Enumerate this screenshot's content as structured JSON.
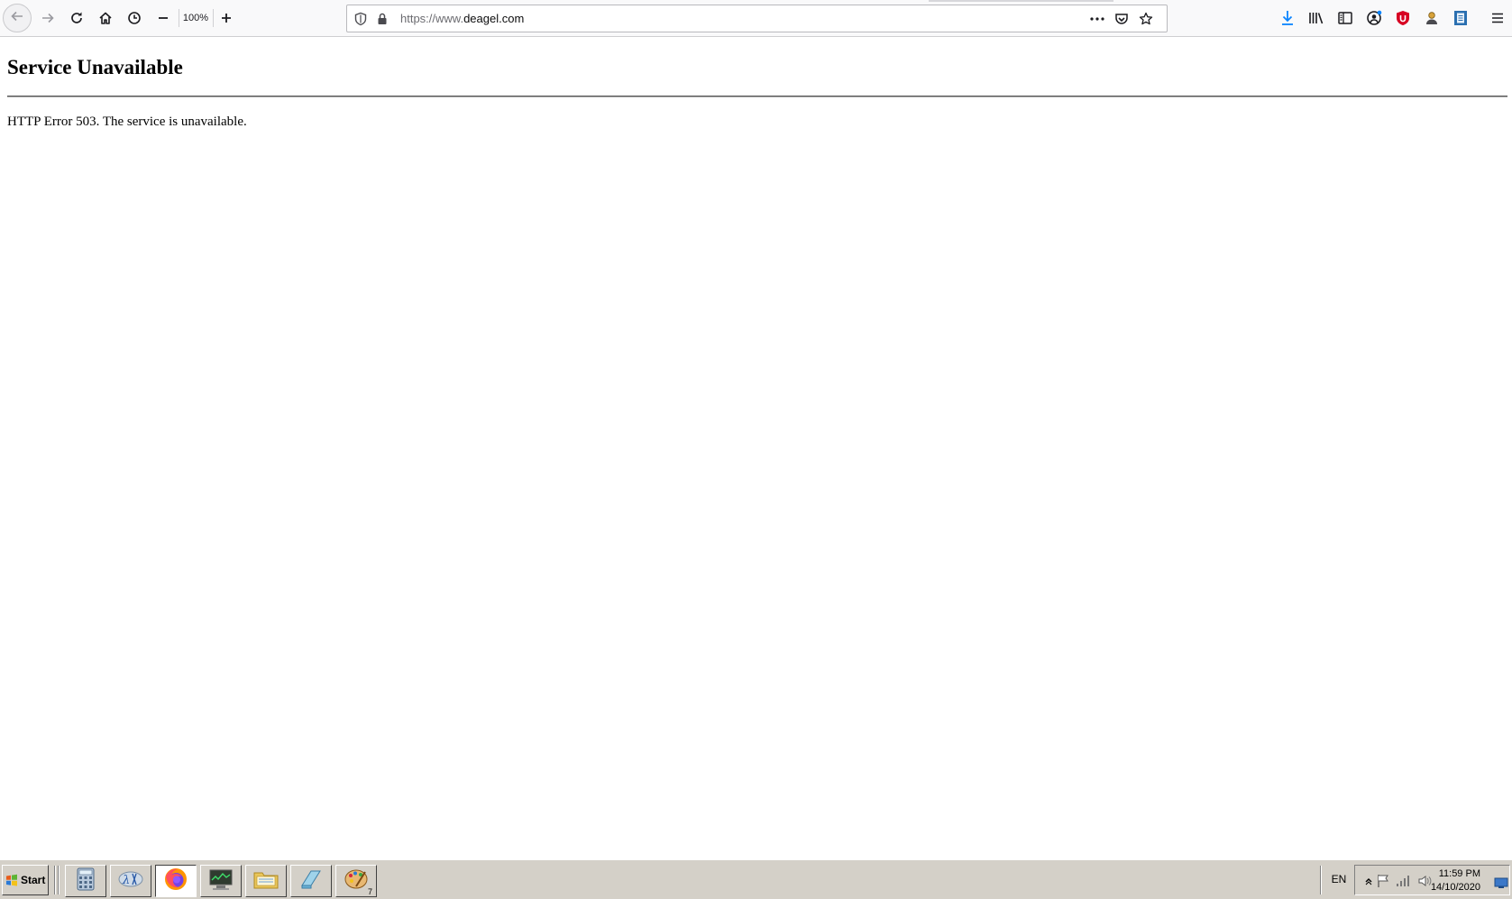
{
  "browser": {
    "zoom_level": "100%",
    "url_protocol": "https://www.",
    "url_host": "deagel.com",
    "icons": {
      "back": "back-arrow-icon",
      "forward": "forward-arrow-icon",
      "reload": "reload-icon",
      "home": "home-icon",
      "history": "history-clock-icon",
      "zoom_out": "minus-icon",
      "zoom_in": "plus-icon",
      "tracking_protection": "shield-icon",
      "secure": "lock-icon",
      "page_actions": "more-dots-icon",
      "pocket": "pocket-icon",
      "bookmark": "star-icon",
      "downloads": "download-icon",
      "library": "library-icon",
      "sidebar": "sidebar-icon",
      "account": "account-icon",
      "ublock": "ublock-icon",
      "extension": "extension-icon",
      "reader": "reader-icon",
      "menu": "hamburger-menu-icon"
    },
    "accent_color": "#0a84ff"
  },
  "page": {
    "heading": "Service Unavailable",
    "message": "HTTP Error 503. The service is unavailable."
  },
  "taskbar": {
    "start_label": "Start",
    "items": [
      {
        "name": "calculator",
        "icon": "calculator-icon"
      },
      {
        "name": "lambda-app",
        "icon": "lambda-icon"
      },
      {
        "name": "firefox",
        "icon": "firefox-icon",
        "active": true
      },
      {
        "name": "network-monitor",
        "icon": "monitor-icon"
      },
      {
        "name": "file-explorer",
        "icon": "folder-icon"
      },
      {
        "name": "notepad",
        "icon": "notepad-icon"
      },
      {
        "name": "paint",
        "icon": "paint-palette-icon",
        "badge": "7"
      }
    ],
    "language": "EN",
    "clock_time": "11:59 PM",
    "clock_date": "14/10/2020"
  }
}
